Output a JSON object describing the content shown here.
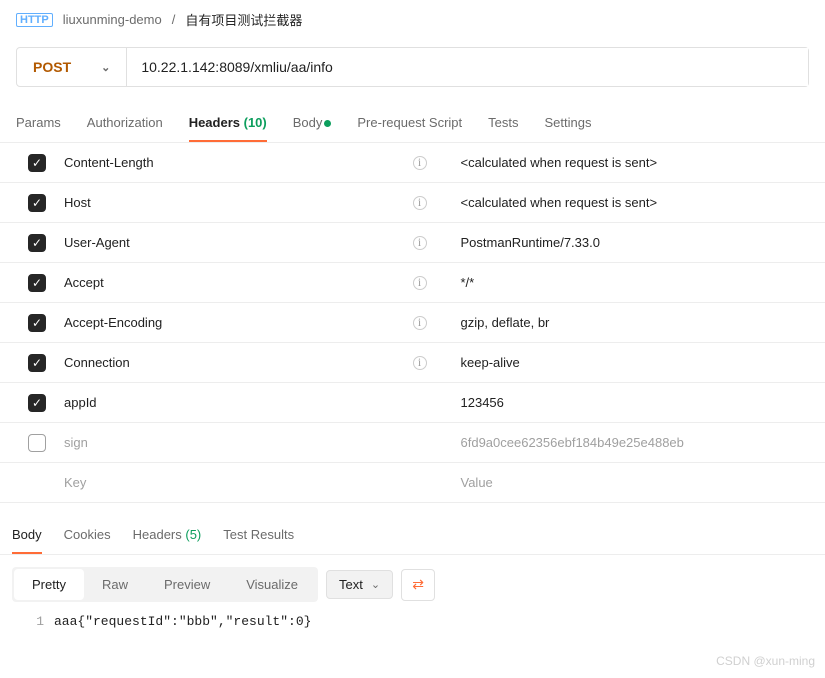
{
  "breadcrumb": {
    "collection": "liuxunming-demo",
    "name": "自有项目测试拦截器"
  },
  "request": {
    "method": "POST",
    "url": "10.22.1.142:8089/xmliu/aa/info"
  },
  "tabs": {
    "params": "Params",
    "auth": "Authorization",
    "headers_label": "Headers",
    "headers_count": "(10)",
    "body": "Body",
    "prereq": "Pre-request Script",
    "tests": "Tests",
    "settings": "Settings"
  },
  "headers": [
    {
      "checked": true,
      "key": "Content-Length",
      "info": true,
      "value": "<calculated when request is sent>",
      "grey": false
    },
    {
      "checked": true,
      "key": "Host",
      "info": true,
      "value": "<calculated when request is sent>",
      "grey": false
    },
    {
      "checked": true,
      "key": "User-Agent",
      "info": true,
      "value": "PostmanRuntime/7.33.0",
      "grey": false
    },
    {
      "checked": true,
      "key": "Accept",
      "info": true,
      "value": "*/*",
      "grey": false
    },
    {
      "checked": true,
      "key": "Accept-Encoding",
      "info": true,
      "value": "gzip, deflate, br",
      "grey": false
    },
    {
      "checked": true,
      "key": "Connection",
      "info": true,
      "value": "keep-alive",
      "grey": false
    },
    {
      "checked": true,
      "key": "appId",
      "info": false,
      "value": "123456",
      "grey": false
    },
    {
      "checked": false,
      "key": "sign",
      "info": false,
      "value": "6fd9a0cee62356ebf184b49e25e488eb",
      "grey": true
    }
  ],
  "header_placeholders": {
    "key": "Key",
    "value": "Value"
  },
  "response_tabs": {
    "body": "Body",
    "cookies": "Cookies",
    "headers_label": "Headers",
    "headers_count": "(5)",
    "tests": "Test Results"
  },
  "response_toolbar": {
    "pretty": "Pretty",
    "raw": "Raw",
    "preview": "Preview",
    "visualize": "Visualize",
    "format": "Text"
  },
  "response_body": {
    "line_no": "1",
    "content": "aaa{\"requestId\":\"bbb\",\"result\":0}"
  },
  "watermark": "CSDN @xun-ming"
}
